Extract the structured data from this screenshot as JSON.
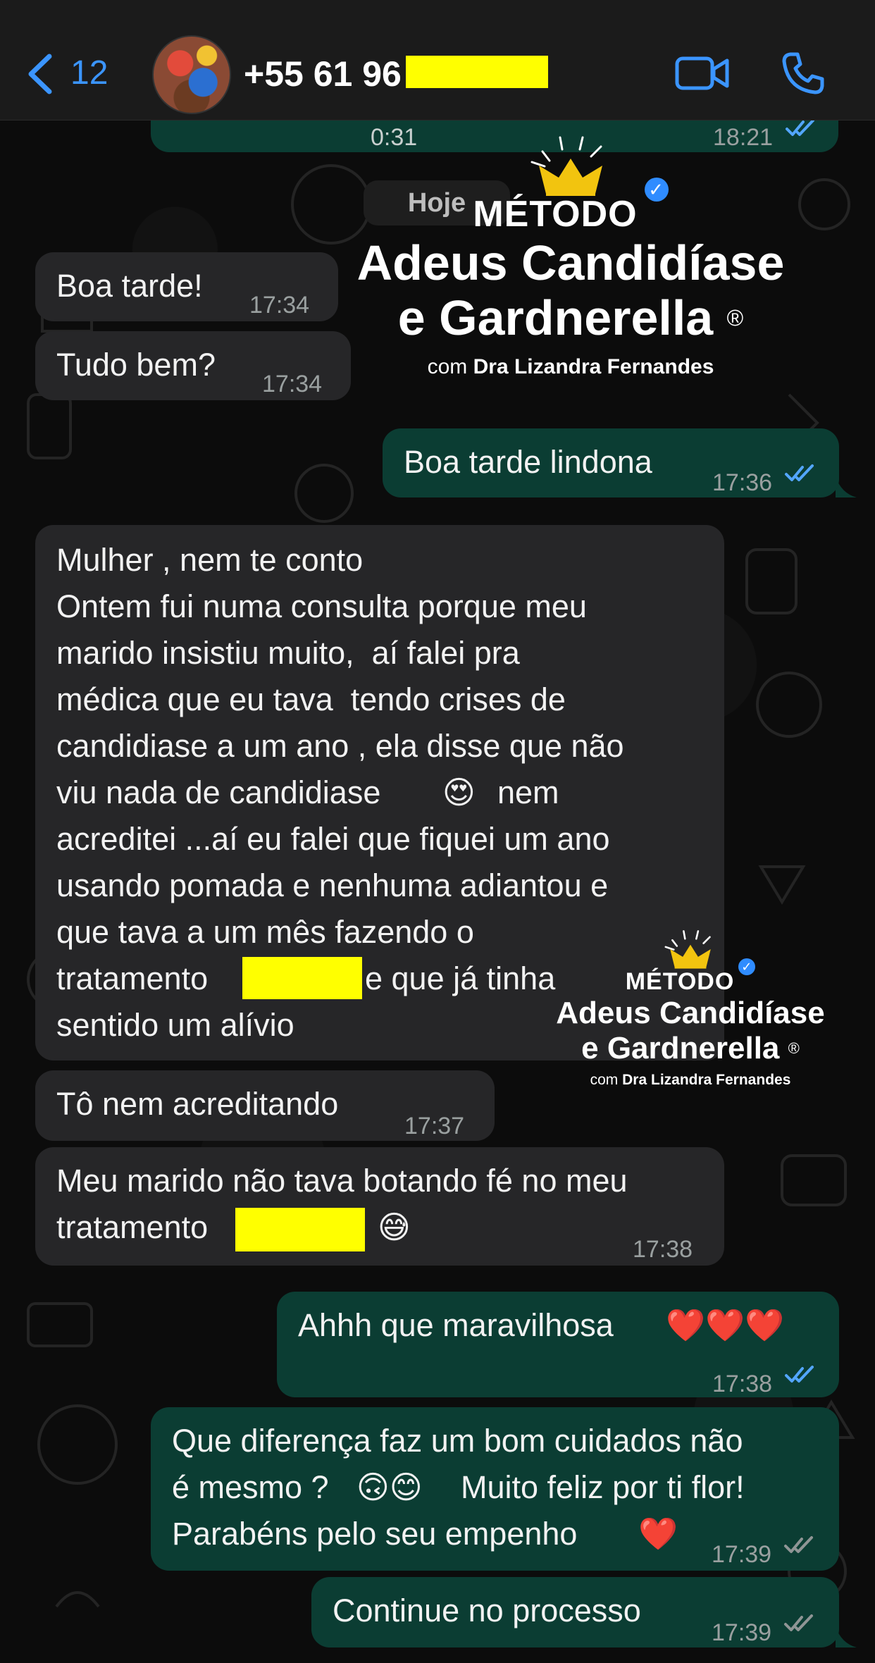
{
  "header": {
    "back_count": "12",
    "contact_name": "+55 61 96"
  },
  "top_audio": {
    "duration": "0:31",
    "time": "18:21"
  },
  "date_separator": "Hoje",
  "messages": [
    {
      "dir": "in",
      "text": "Boa tarde!",
      "time": "17:34"
    },
    {
      "dir": "in",
      "text": "Tudo bem?",
      "time": "17:34"
    },
    {
      "dir": "out",
      "text": "Boa tarde lindona",
      "time": "17:36"
    },
    {
      "dir": "in",
      "lines": [
        "Mulher , nem te conto",
        "Ontem fui numa consulta porque meu",
        "marido insistiu muito,  aí falei pra",
        "médica que eu tava  tendo crises de",
        "candidiase a um ano , ela disse que não",
        "viu nada de candidiase",
        "nem",
        "acreditei ...aí eu falei que fiquei um ano",
        "usando pomada e nenhuma adiantou e",
        "que tava a um mês fazendo o",
        "tratamento",
        "e que já tinha",
        "sentido um alívio"
      ],
      "emoji": "😍"
    },
    {
      "dir": "in",
      "text": "Tô nem acreditando",
      "time": "17:37"
    },
    {
      "dir": "in",
      "lines": [
        "Meu marido não tava botando fé no meu",
        "tratamento"
      ],
      "emoji": "😅",
      "time": "17:38"
    },
    {
      "dir": "out",
      "text": "Ahhh que maravilhosa",
      "emoji": "❤️❤️❤️",
      "time": "17:38"
    },
    {
      "dir": "out",
      "lines": [
        "Que diferença faz um bom cuidados não",
        "é mesmo ?",
        "Muito feliz por ti flor!",
        "Parabéns pelo seu empenho"
      ],
      "emoji_a": "🙃😊",
      "emoji_b": "❤️",
      "time": "17:39"
    },
    {
      "dir": "out",
      "text": "Continue no processo",
      "time": "17:39"
    }
  ],
  "watermark": {
    "line1": "MÉTODO",
    "line2": "Adeus Candidíase",
    "line3": "e Gardnerella",
    "registered": "®",
    "line4_prefix": "com",
    "line4_name": "Dra Lizandra Fernandes"
  },
  "colors": {
    "incoming_bubble": "#262628",
    "outgoing_bubble": "#0b3d33",
    "accent_blue": "#3b95ff",
    "read_ticks": "#53a6ff",
    "redaction": "#ffff00",
    "crown": "#f2c40f"
  },
  "icons": [
    "chevron-left-icon",
    "video-camera-icon",
    "phone-icon",
    "double-check-icon",
    "crown-icon",
    "verified-badge-icon"
  ]
}
